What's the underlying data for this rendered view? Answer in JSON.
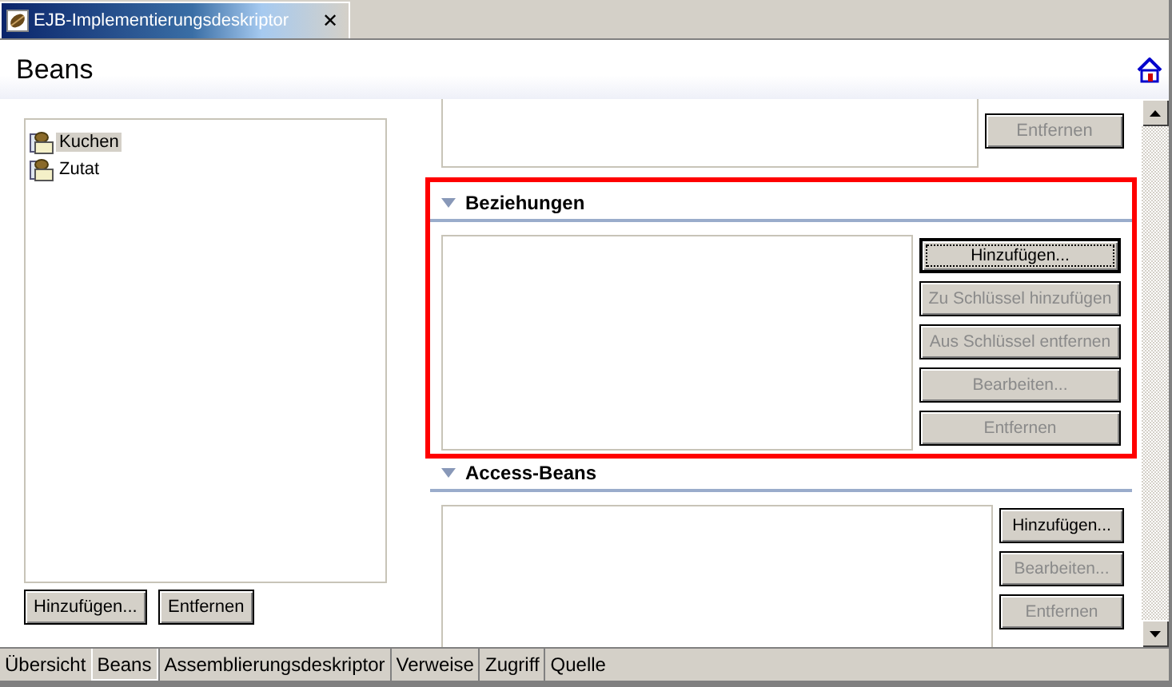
{
  "editor_tab": {
    "title": "EJB-Implementierungsdeskriptor",
    "close": "✕"
  },
  "page_title": "Beans",
  "beans": {
    "items": [
      {
        "label": "Kuchen",
        "selected": true
      },
      {
        "label": "Zutat",
        "selected": false
      }
    ],
    "buttons": [
      {
        "label": "Hinzufügen...",
        "disabled": false
      },
      {
        "label": "Entfernen",
        "disabled": false
      }
    ]
  },
  "sections": [
    {
      "kind": "partial",
      "buttons": [
        {
          "label": "Entfernen",
          "disabled": true
        }
      ]
    },
    {
      "kind": "full",
      "title": "Beziehungen",
      "expanded": true,
      "highlighted": true,
      "buttons": [
        {
          "label": "Hinzufügen...",
          "disabled": false,
          "focused": true
        },
        {
          "label": "Zu Schlüssel hinzufügen",
          "disabled": true,
          "focused": false
        },
        {
          "label": "Aus Schlüssel entfernen",
          "disabled": true,
          "focused": false
        },
        {
          "label": "Bearbeiten...",
          "disabled": true,
          "focused": false
        },
        {
          "label": "Entfernen",
          "disabled": true,
          "focused": false
        }
      ]
    },
    {
      "kind": "full",
      "title": "Access-Beans",
      "expanded": true,
      "highlighted": false,
      "buttons": [
        {
          "label": "Hinzufügen...",
          "disabled": false,
          "focused": false
        },
        {
          "label": "Bearbeiten...",
          "disabled": true,
          "focused": false
        },
        {
          "label": "Entfernen",
          "disabled": true,
          "focused": false
        }
      ]
    }
  ],
  "page_tabs": [
    {
      "label": "Übersicht",
      "selected": false
    },
    {
      "label": "Beans",
      "selected": true
    },
    {
      "label": "Assemblierungsdeskriptor",
      "selected": false
    },
    {
      "label": "Verweise",
      "selected": false
    },
    {
      "label": "Zugriff",
      "selected": false
    },
    {
      "label": "Quelle",
      "selected": false
    }
  ]
}
